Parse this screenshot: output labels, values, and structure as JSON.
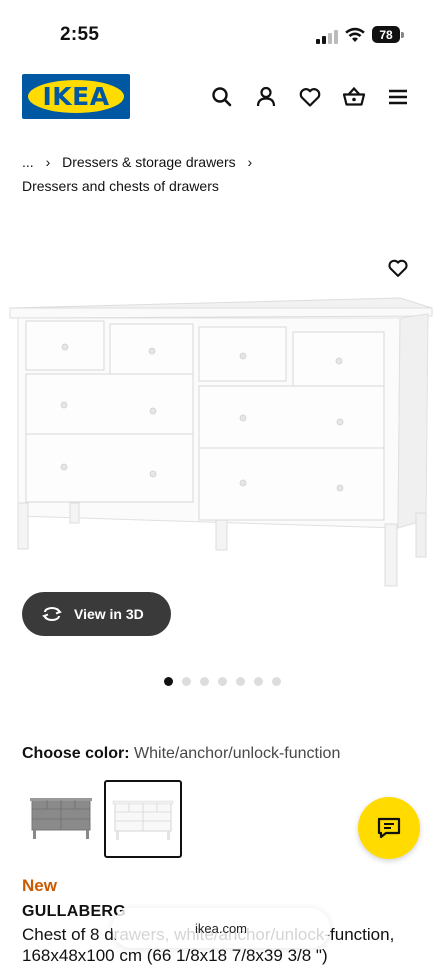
{
  "status_bar": {
    "time": "2:55",
    "battery": "78"
  },
  "header": {
    "logo_text": "IKEA",
    "icons": [
      "search-icon",
      "account-icon",
      "heart-icon",
      "basket-icon",
      "menu-icon"
    ]
  },
  "breadcrumb": {
    "ellipsis": "...",
    "separator": "›",
    "parent": "Dressers & storage drawers",
    "current": "Dressers and chests of drawers"
  },
  "gallery": {
    "view_3d_label": "View in 3D",
    "dot_count": 7,
    "active_dot": 0
  },
  "color": {
    "label": "Choose color:",
    "value": "White/anchor/unlock-function"
  },
  "product": {
    "badge": "New",
    "name": "GULLABERG",
    "description": "Chest of 8 drawers, white/anchor/unlock-function, 168x48x100 cm (66 1/8x18 7/8x39 3/8 \")"
  },
  "browser": {
    "url": "ikea.com"
  },
  "colors": {
    "ikea_blue": "#0058a3",
    "ikea_yellow": "#ffdb00",
    "new_badge": "#cc5a00",
    "view3d_bg": "#3a3a3a"
  }
}
